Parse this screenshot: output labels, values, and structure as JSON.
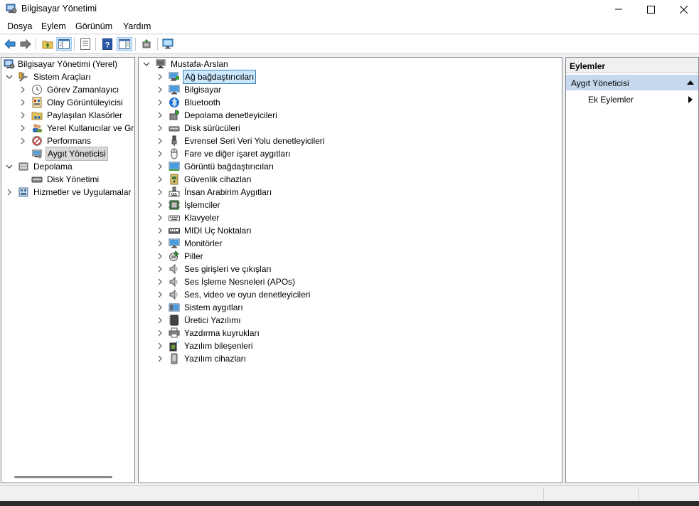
{
  "window": {
    "title": "Bilgisayar Yönetimi"
  },
  "menu": [
    "Dosya",
    "Eylem",
    "Görünüm",
    "Yardım"
  ],
  "left_tree": {
    "root": "Bilgisayar Yönetimi (Yerel)",
    "items": [
      {
        "label": "Sistem Araçları",
        "level": 1,
        "expanded": true,
        "icon": "tools-icon"
      },
      {
        "label": "Görev Zamanlayıcı",
        "level": 2,
        "icon": "clock-icon"
      },
      {
        "label": "Olay Görüntüleyicisi",
        "level": 2,
        "icon": "event-viewer-icon"
      },
      {
        "label": "Paylaşılan Klasörler",
        "level": 2,
        "icon": "shared-folder-icon"
      },
      {
        "label": "Yerel Kullanıcılar ve Gru",
        "level": 2,
        "icon": "users-icon"
      },
      {
        "label": "Performans",
        "level": 2,
        "icon": "performance-icon"
      },
      {
        "label": "Aygıt Yöneticisi",
        "level": 2,
        "icon": "device-manager-icon",
        "selected": true
      },
      {
        "label": "Depolama",
        "level": 1,
        "expanded": true,
        "icon": "storage-icon"
      },
      {
        "label": "Disk Yönetimi",
        "level": 2,
        "icon": "disk-icon"
      },
      {
        "label": "Hizmetler ve Uygulamalar",
        "level": 1,
        "expanded": false,
        "icon": "services-icon"
      }
    ]
  },
  "device_tree": {
    "root": "Mustafa-Arslan",
    "categories": [
      {
        "label": "Ağ bağdaştırıcıları",
        "icon": "network-adapter-icon",
        "selected": true
      },
      {
        "label": "Bilgisayar",
        "icon": "computer-icon"
      },
      {
        "label": "Bluetooth",
        "icon": "bluetooth-icon"
      },
      {
        "label": "Depolama denetleyicileri",
        "icon": "storage-controller-icon"
      },
      {
        "label": "Disk sürücüleri",
        "icon": "disk-drive-icon"
      },
      {
        "label": "Evrensel Seri Veri Yolu denetleyicileri",
        "icon": "usb-icon"
      },
      {
        "label": "Fare ve diğer işaret aygıtları",
        "icon": "mouse-icon"
      },
      {
        "label": "Görüntü bağdaştırıcıları",
        "icon": "display-adapter-icon"
      },
      {
        "label": "Güvenlik cihazları",
        "icon": "security-device-icon"
      },
      {
        "label": "İnsan Arabirim Aygıtları",
        "icon": "hid-icon"
      },
      {
        "label": "İşlemciler",
        "icon": "processor-icon"
      },
      {
        "label": "Klavyeler",
        "icon": "keyboard-icon"
      },
      {
        "label": "MIDI Uç Noktaları",
        "icon": "midi-icon"
      },
      {
        "label": "Monitörler",
        "icon": "monitor-icon"
      },
      {
        "label": "Piller",
        "icon": "battery-icon"
      },
      {
        "label": "Ses girişleri ve çıkışları",
        "icon": "speaker-icon"
      },
      {
        "label": "Ses İşleme Nesneleri (APOs)",
        "icon": "speaker-icon"
      },
      {
        "label": "Ses, video ve oyun denetleyicileri",
        "icon": "speaker-icon"
      },
      {
        "label": "Sistem aygıtları",
        "icon": "system-device-icon"
      },
      {
        "label": "Üretici Yazılımı",
        "icon": "firmware-icon"
      },
      {
        "label": "Yazdırma kuyrukları",
        "icon": "printer-icon"
      },
      {
        "label": "Yazılım bileşenleri",
        "icon": "software-component-icon"
      },
      {
        "label": "Yazılım cihazları",
        "icon": "software-device-icon"
      }
    ]
  },
  "actions": {
    "header": "Eylemler",
    "section": "Aygıt Yöneticisi",
    "item": "Ek Eylemler"
  }
}
